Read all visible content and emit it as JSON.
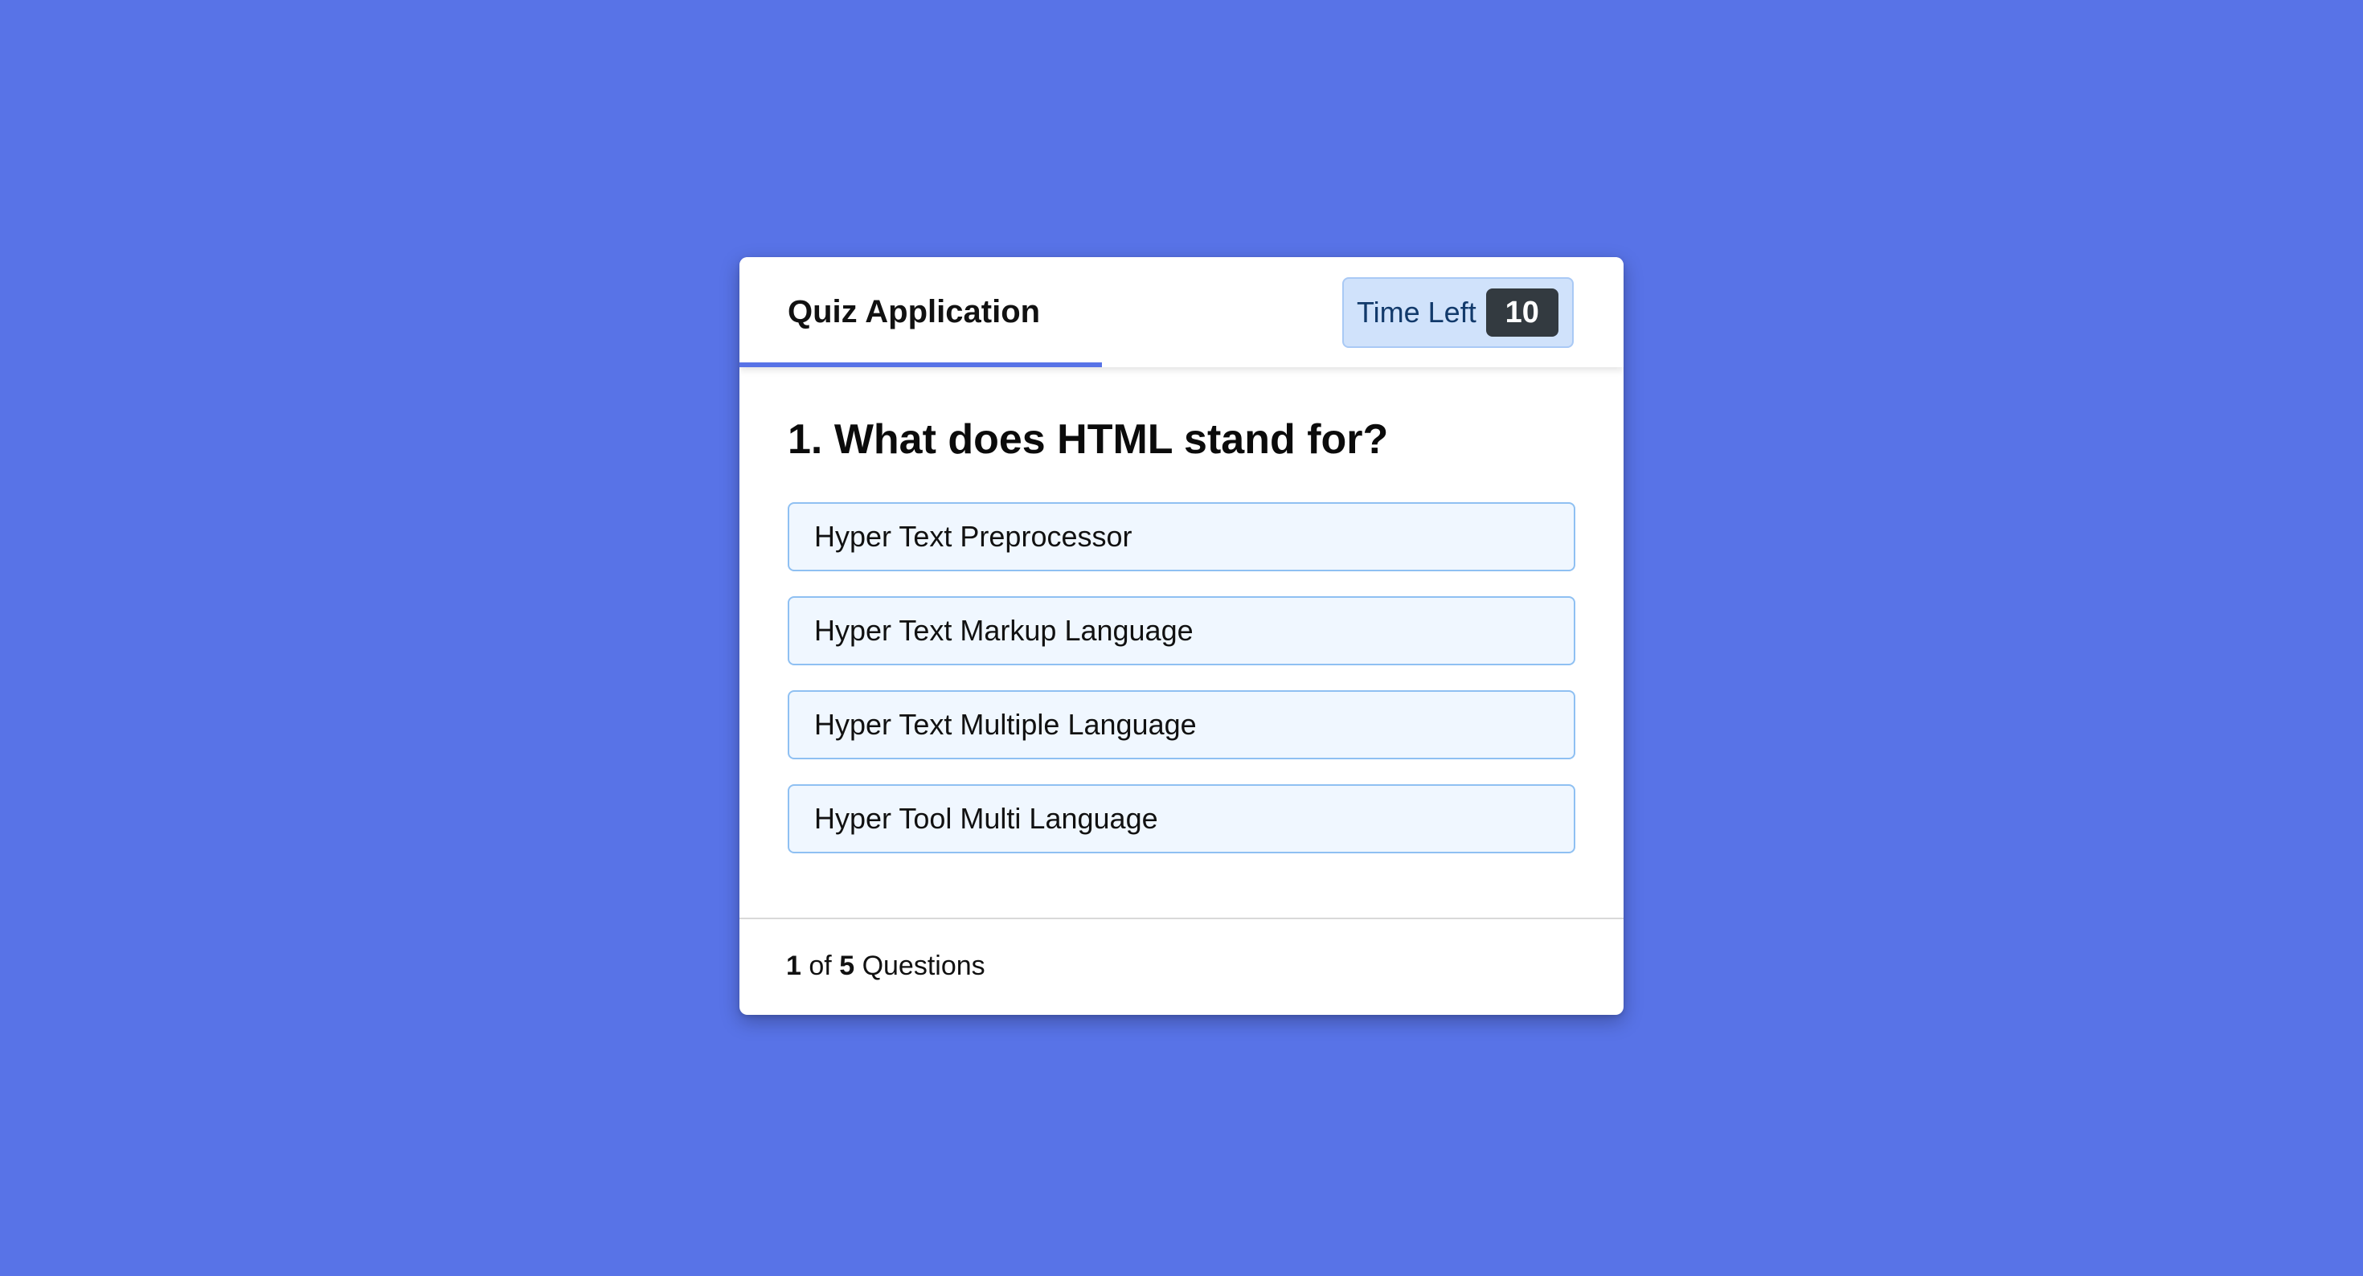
{
  "header": {
    "title": "Quiz Application",
    "timer_label": "Time Left",
    "timer_seconds": "10",
    "time_progress": 0.41
  },
  "question": {
    "text": "1. What does HTML stand for?",
    "options": [
      "Hyper Text Preprocessor",
      "Hyper Text Markup Language",
      "Hyper Text Multiple Language",
      "Hyper Tool Multi Language"
    ]
  },
  "footer": {
    "current": "1",
    "of_label": "of",
    "total": "5",
    "questions_label": "Questions"
  },
  "colors": {
    "background": "#5873e7",
    "accent": "#5873e7",
    "timer_bg": "#d0e2fb",
    "timer_counter_bg": "#333a40",
    "option_bg": "#f0f7ff",
    "option_border": "#8fc0f2"
  }
}
